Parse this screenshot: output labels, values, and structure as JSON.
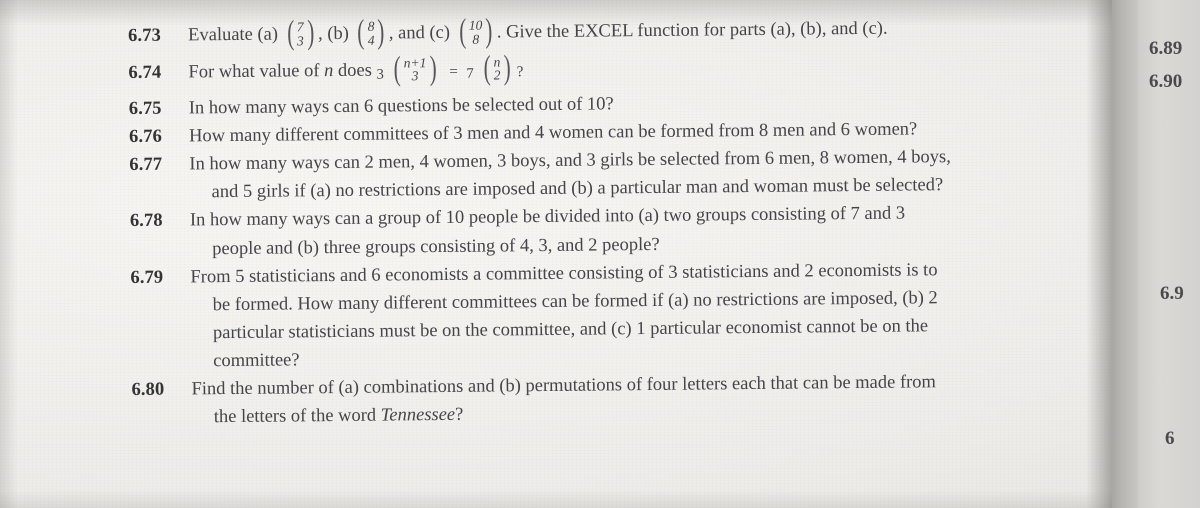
{
  "page": {
    "kind": "scanned-textbook-page",
    "paper_color": "#f3f2ef",
    "ink_color": "#44444a",
    "gutter_color": "#b9b7b4",
    "facing_page_color": "#d4d2cf"
  },
  "problems": [
    {
      "number": "6.73",
      "lines": [
        "Evaluate (a)",
        ", (b)",
        ", and (c)",
        ". Give the EXCEL function for parts (a), (b), and (c)."
      ],
      "binomials": [
        {
          "top": "7",
          "bottom": "3"
        },
        {
          "top": "8",
          "bottom": "4"
        },
        {
          "top": "10",
          "bottom": "8"
        }
      ]
    },
    {
      "number": "6.74",
      "lead": "For what value of n does",
      "coefficient_left": "3",
      "binomial_left": {
        "top": "n+1",
        "bottom": "3"
      },
      "equals": "=",
      "coefficient_right": "7",
      "binomial_right": {
        "top": "n",
        "bottom": "2"
      },
      "trailing": "?"
    },
    {
      "number": "6.75",
      "text": "In how many ways can 6 questions be selected out of 10?"
    },
    {
      "number": "6.76",
      "text": "How many different committees of 3 men and 4 women can be formed from 8 men and 6 women?"
    },
    {
      "number": "6.77",
      "line1": "In how many ways can 2 men, 4 women, 3 boys, and 3 girls be selected from 6 men, 8 women, 4 boys,",
      "line2": "and 5 girls if (a) no restrictions are imposed and (b) a particular man and woman must be selected?"
    },
    {
      "number": "6.78",
      "line1": "In how many ways can a group of 10 people be divided into (a) two groups consisting of 7 and 3",
      "line2": "people and (b) three groups consisting of 4, 3, and 2 people?"
    },
    {
      "number": "6.79",
      "line1": "From 5 statisticians and 6 economists a committee consisting of 3 statisticians and 2 economists is to",
      "line2": "be formed. How many different committees can be formed if (a) no restrictions are imposed, (b) 2",
      "line3": "particular statisticians must be on the committee, and (c) 1 particular economist cannot be on the",
      "line4": "committee?"
    },
    {
      "number": "6.80",
      "line1": "Find the number of (a) combinations and (b) permutations of four letters each that can be made from",
      "line2_before": "the letters of the word ",
      "line2_italic": "Tennessee",
      "line2_after": "?"
    }
  ],
  "margin_numbers": [
    "6.89",
    "6.90",
    "6.9",
    "6"
  ]
}
